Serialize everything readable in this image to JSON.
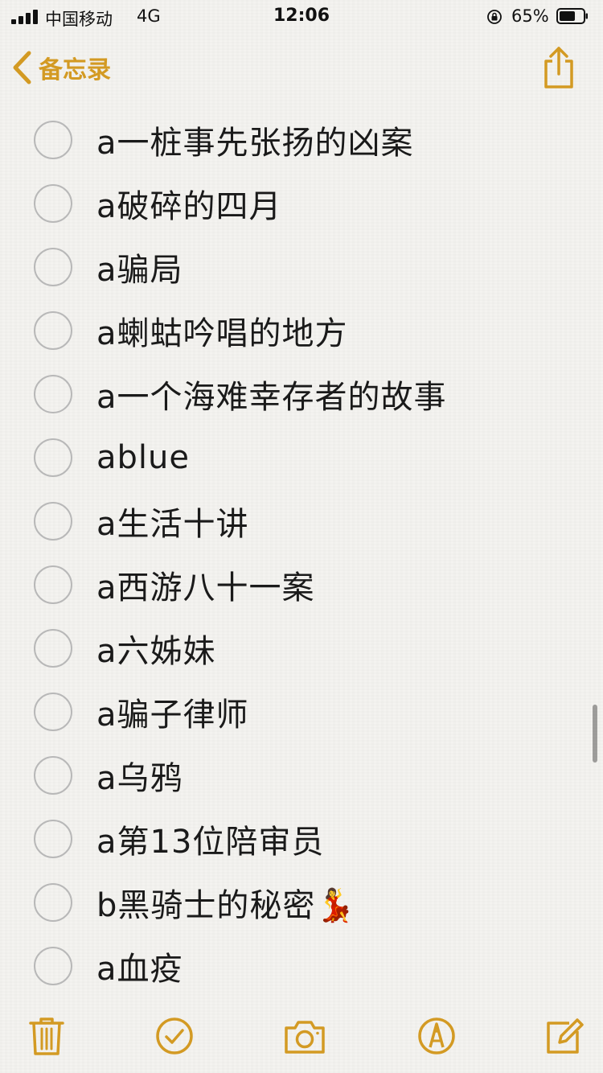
{
  "status_bar": {
    "carrier": "中国移动",
    "network": "4G",
    "time": "12:06",
    "battery_percent": "65%"
  },
  "nav": {
    "back_label": "备忘录",
    "accent_color": "#d39a23"
  },
  "checklist": {
    "items": [
      {
        "text": "a一桩事先张扬的凶案",
        "checked": false
      },
      {
        "text": "a破碎的四月",
        "checked": false
      },
      {
        "text": "a骗局",
        "checked": false
      },
      {
        "text": "a蝲蛄吟唱的地方",
        "checked": false
      },
      {
        "text": "a一个海难幸存者的故事",
        "checked": false
      },
      {
        "text": "ablue",
        "checked": false
      },
      {
        "text": "a生活十讲",
        "checked": false
      },
      {
        "text": "a西游八十一案",
        "checked": false
      },
      {
        "text": "a六姊妹",
        "checked": false
      },
      {
        "text": "a骗子律师",
        "checked": false
      },
      {
        "text": "a乌鸦",
        "checked": false
      },
      {
        "text": "a第13位陪审员",
        "checked": false
      },
      {
        "text": "b黑骑士的秘密💃",
        "checked": false
      },
      {
        "text": "a血疫",
        "checked": false
      }
    ]
  },
  "toolbar": {
    "icons": [
      "trash-icon",
      "checklist-icon",
      "camera-icon",
      "markup-icon",
      "compose-icon"
    ]
  }
}
